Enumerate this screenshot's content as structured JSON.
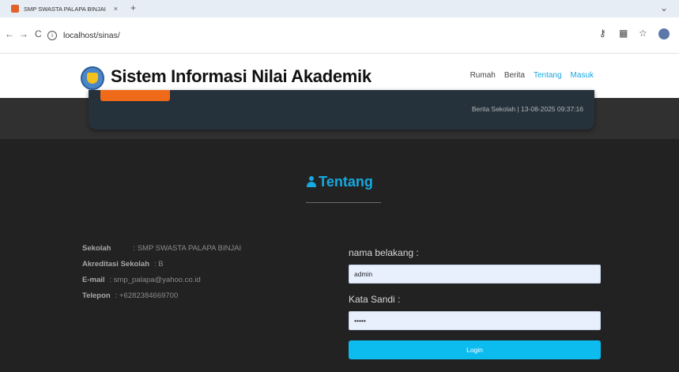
{
  "browser": {
    "tab_title": "SMP SWASTA PALAPA BINJAI",
    "tab_close": "×",
    "new_tab": "+",
    "window_control": "⌄",
    "back": "←",
    "forward": "→",
    "reload": "C",
    "url": "localhost/sinas/",
    "icons": [
      "info-icon",
      "key-icon",
      "extension-icon",
      "star-icon",
      "profile-icon"
    ]
  },
  "site": {
    "brand": "Sistem Informasi Nilai Akademik",
    "menu": {
      "home": "Rumah",
      "news": "Berita",
      "about": "Tentang",
      "login": "Masuk"
    }
  },
  "banner": {
    "caption": "Berita Sekolah | 13-08-2025 09:37:16"
  },
  "about": {
    "title": "Tentang",
    "school_label": "Sekolah",
    "school_value": ": SMP SWASTA PALAPA BINJAI",
    "accreditation_label": "Akreditasi Sekolah",
    "accreditation_value": ": B",
    "email_label": "E-mail",
    "email_value": ": smp_palapa@yahoo.co.id",
    "phone_label": "Telepon",
    "phone_value": ": +6282384669700"
  },
  "login_form": {
    "username_label": "nama belakang :",
    "username_value": "admin",
    "password_label": "Kata Sandi :",
    "password_value": "•••••",
    "submit_label": "Login"
  },
  "colors": {
    "accent": "#16a8e0",
    "button": "#0cbcef",
    "banner_button": "#ef6a19",
    "dark_bg": "#222222"
  }
}
